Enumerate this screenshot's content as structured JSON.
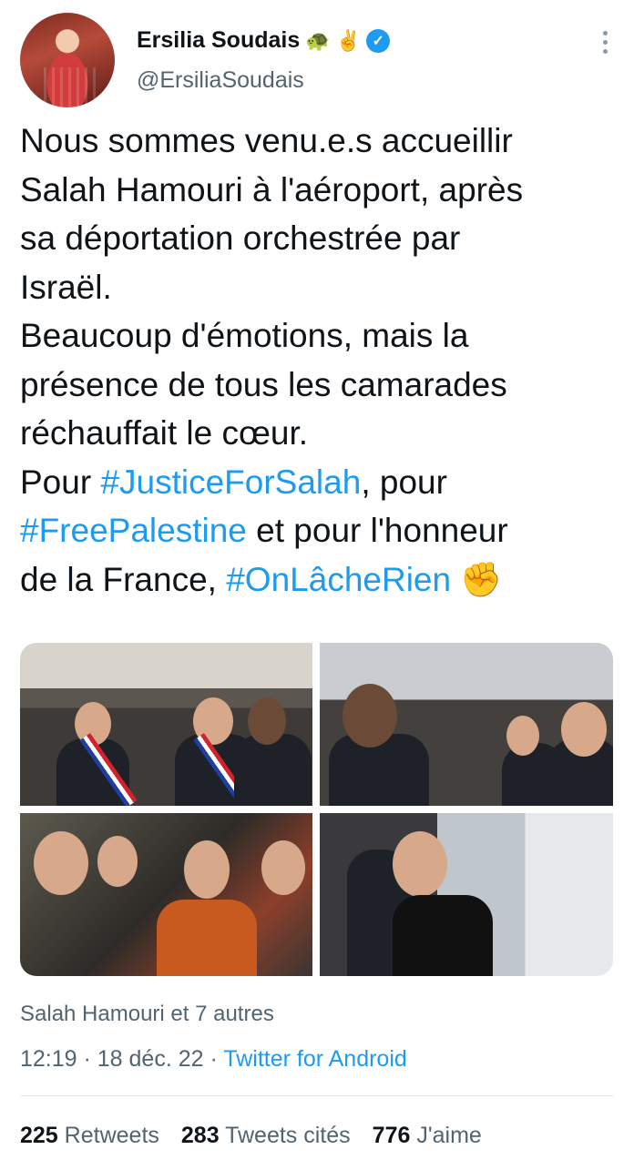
{
  "author": {
    "name": "Ersilia Soudais",
    "handle": "@ErsiliaSoudais",
    "emoji": "🐢 ✌️"
  },
  "tweet": {
    "line1": "Nous sommes venu.e.s accueillir\nSalah Hamouri à l'aéroport, après\nsa déportation orchestrée par\nIsraël.\nBeaucoup d'émotions, mais la\nprésence de tous les camarades\nréchauffait le cœur.\nPour ",
    "tag1": "#JusticeForSalah",
    "mid1": ", pour\n",
    "tag2": "#FreePalestine",
    "mid2": " et pour l'honneur\nde la France, ",
    "tag3": "#OnLâcheRien",
    "end": " ✊"
  },
  "tagged": "Salah Hamouri et 7 autres",
  "timestamp": "12:19 · 18 déc. 22 · ",
  "source": "Twitter for Android",
  "stats": {
    "retweets_count": "225",
    "retweets_label": "Retweets",
    "quotes_count": "283",
    "quotes_label": "Tweets cités",
    "likes_count": "776",
    "likes_label": "J'aime"
  },
  "colors": {
    "accent": "#1d9bf0",
    "muted": "#536471"
  }
}
